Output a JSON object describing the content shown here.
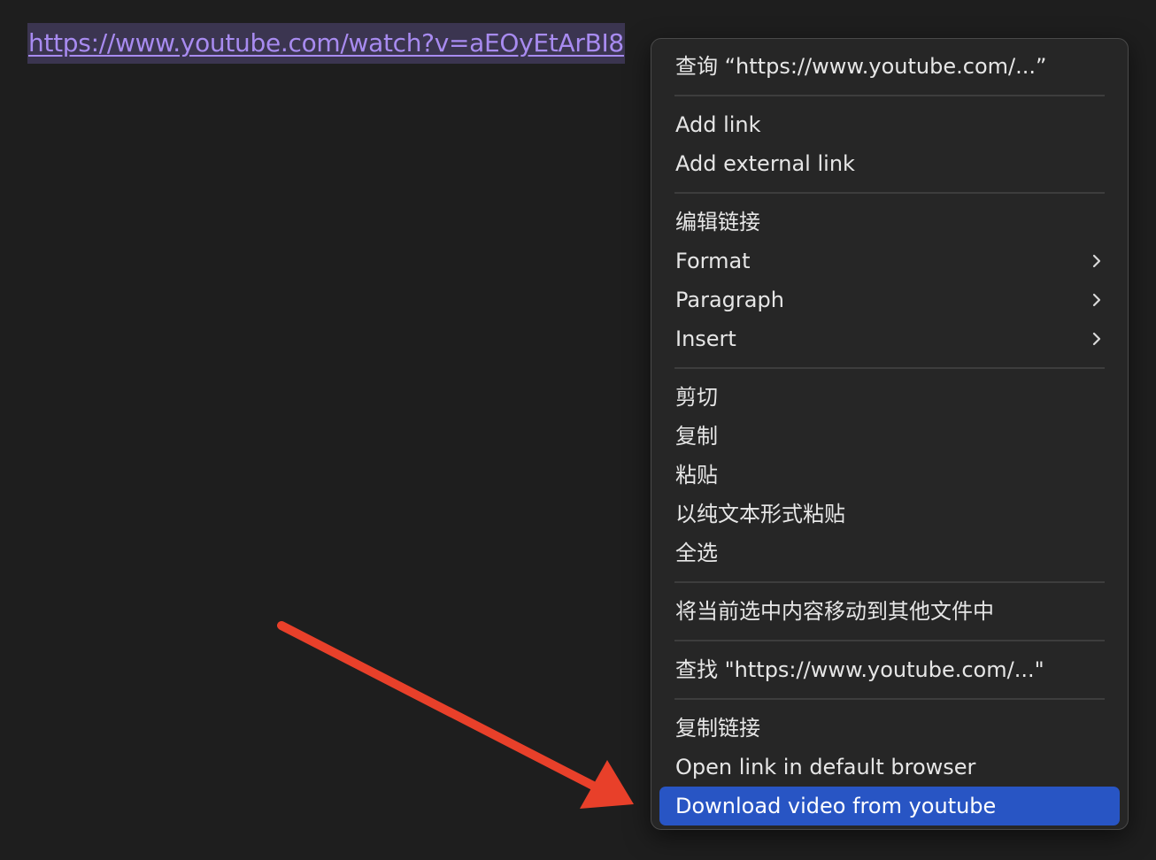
{
  "editor": {
    "selected_link": "https://www.youtube.com/watch?v=aEOyEtArBI8"
  },
  "context_menu": {
    "groups": [
      [
        {
          "label": "查询 “https://www.youtube.com/...”",
          "submenu": false
        }
      ],
      [
        {
          "label": "Add link",
          "submenu": false
        },
        {
          "label": "Add external link",
          "submenu": false
        }
      ],
      [
        {
          "label": "编辑链接",
          "submenu": false
        },
        {
          "label": "Format",
          "submenu": true
        },
        {
          "label": "Paragraph",
          "submenu": true
        },
        {
          "label": "Insert",
          "submenu": true
        }
      ],
      [
        {
          "label": "剪切",
          "submenu": false
        },
        {
          "label": "复制",
          "submenu": false
        },
        {
          "label": "粘贴",
          "submenu": false
        },
        {
          "label": "以纯文本形式粘贴",
          "submenu": false
        },
        {
          "label": "全选",
          "submenu": false
        }
      ],
      [
        {
          "label": "将当前选中内容移动到其他文件中",
          "submenu": false
        }
      ],
      [
        {
          "label": "查找 \"https://www.youtube.com/...\"",
          "submenu": false
        }
      ],
      [
        {
          "label": "复制链接",
          "submenu": false
        },
        {
          "label": "Open link in default browser",
          "submenu": false
        },
        {
          "label": "Download video from youtube",
          "submenu": false,
          "highlighted": true
        }
      ]
    ]
  },
  "colors": {
    "background": "#1e1e1e",
    "menu_background": "#262626",
    "highlight": "#2855c4",
    "link_text": "#a88bf0",
    "annotation_arrow": "#e8402a"
  },
  "icons": {
    "submenu": "chevron-right-icon",
    "annotation": "red-arrow-annotation"
  }
}
